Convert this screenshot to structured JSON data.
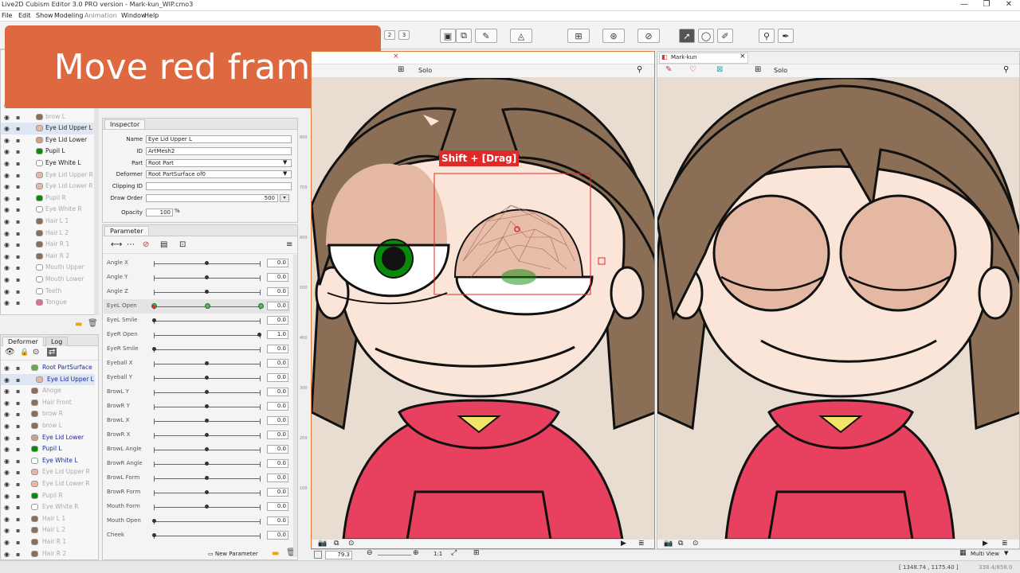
{
  "app": {
    "title": "Live2D Cubism Editor 3.0   PRO version  - Mark-kun_WIP.cmo3",
    "min": "—",
    "max": "❐",
    "close": "✕"
  },
  "menu": [
    "File",
    "Edit",
    "Show",
    "Modeling",
    "Animation",
    "Window",
    "Help"
  ],
  "toolbar": {
    "pages": [
      "1",
      "2",
      "3"
    ]
  },
  "overlay": {
    "text": "Move red frame"
  },
  "parts_tree": {
    "items": [
      {
        "label": "Eyes",
        "color": "#e5b8a4",
        "dim": true
      },
      {
        "label": "brow L",
        "color": "#8a6e55",
        "dim": true
      },
      {
        "label": "Eye Lid Upper L",
        "color": "#e5b8a4",
        "dim": false,
        "selected": true
      },
      {
        "label": "Eye Lid Lower",
        "color": "#c9a28c",
        "dim": false
      },
      {
        "label": "Pupil L",
        "color": "#0a8a0a",
        "dim": false
      },
      {
        "label": "Eye White L",
        "color": "#ffffff",
        "dim": false
      },
      {
        "label": "Eye Lid Upper R",
        "color": "#e5b8a4",
        "dim": true
      },
      {
        "label": "Eye Lid Lower R",
        "color": "#e5b8a4",
        "dim": true
      },
      {
        "label": "Pupil R",
        "color": "#0a8a0a",
        "dim": true
      },
      {
        "label": "Eye White R",
        "color": "#ffffff",
        "dim": true
      },
      {
        "label": "Hair L 1",
        "color": "#8a6e55",
        "dim": true
      },
      {
        "label": "Hair L 2",
        "color": "#8a6e55",
        "dim": true
      },
      {
        "label": "Hair R 1",
        "color": "#8a6e55",
        "dim": true
      },
      {
        "label": "Hair R 2",
        "color": "#8a6e55",
        "dim": true
      },
      {
        "label": "Mouth Upper",
        "color": "#ffffff",
        "dim": true
      },
      {
        "label": "Mouth Lower",
        "color": "#ffffff",
        "dim": true
      },
      {
        "label": "Teeth",
        "color": "#ffffff",
        "dim": true
      },
      {
        "label": "Tongue",
        "color": "#e0708a",
        "dim": true
      }
    ]
  },
  "deformer_panel": {
    "tabs": [
      "Deformer",
      "Log"
    ],
    "items": [
      {
        "label": "Root PartSurface",
        "color": "#6aa84f",
        "dim": false,
        "indent": 0
      },
      {
        "label": "Eye Lid Upper L",
        "color": "#e5b8a4",
        "dim": false,
        "indent": 1,
        "selected": true
      },
      {
        "label": "Ahoge",
        "color": "#8a6e55",
        "dim": true,
        "indent": 0
      },
      {
        "label": "Hair Front",
        "color": "#8a6e55",
        "dim": true,
        "indent": 0
      },
      {
        "label": "brow R",
        "color": "#8a6e55",
        "dim": true,
        "indent": 0
      },
      {
        "label": "brow L",
        "color": "#8a6e55",
        "dim": true,
        "indent": 0
      },
      {
        "label": "Eye Lid Lower",
        "color": "#c9a28c",
        "dim": false,
        "indent": 0
      },
      {
        "label": "Pupil L",
        "color": "#0a8a0a",
        "dim": false,
        "indent": 0
      },
      {
        "label": "Eye White L",
        "color": "#ffffff",
        "dim": false,
        "indent": 0
      },
      {
        "label": "Eye Lid Upper R",
        "color": "#e5b8a4",
        "dim": true,
        "indent": 0
      },
      {
        "label": "Eye Lid Lower R",
        "color": "#e5b8a4",
        "dim": true,
        "indent": 0
      },
      {
        "label": "Pupil R",
        "color": "#0a8a0a",
        "dim": true,
        "indent": 0
      },
      {
        "label": "Eye White R",
        "color": "#ffffff",
        "dim": true,
        "indent": 0
      },
      {
        "label": "Hair L 1",
        "color": "#8a6e55",
        "dim": true,
        "indent": 0
      },
      {
        "label": "Hair L 2",
        "color": "#8a6e55",
        "dim": true,
        "indent": 0
      },
      {
        "label": "Hair R 1",
        "color": "#8a6e55",
        "dim": true,
        "indent": 0
      },
      {
        "label": "Hair R 2",
        "color": "#8a6e55",
        "dim": true,
        "indent": 0
      }
    ]
  },
  "inspector": {
    "title": "Inspector",
    "name_label": "Name",
    "name_value": "Eye Lid Upper L",
    "id_label": "ID",
    "id_value": "ArtMesh2",
    "part_label": "Part",
    "part_value": "Root Part",
    "deformer_label": "Deformer",
    "deformer_value": "Root PartSurface of0",
    "clip_label": "Clipping ID",
    "clip_value": "",
    "draw_label": "Draw Order",
    "draw_value": "500",
    "opacity_label": "Opacity",
    "opacity_value": "100",
    "opacity_unit": "%"
  },
  "parameter": {
    "title": "Parameter",
    "new_button": "New Parameter",
    "rows": [
      {
        "label": "Angle X",
        "value": "0.0",
        "pos": 0.5
      },
      {
        "label": "Angle Y",
        "value": "0.0",
        "pos": 0.5
      },
      {
        "label": "Angle Z",
        "value": "0.0",
        "pos": 0.5
      },
      {
        "label": "EyeL Open",
        "value": "0.0",
        "pos": 0.0,
        "keys": [
          0,
          0.5,
          1
        ],
        "selected": true
      },
      {
        "label": "EyeL Smile",
        "value": "0.0",
        "pos": 0.0
      },
      {
        "label": "EyeR Open",
        "value": "1.0",
        "pos": 1.0
      },
      {
        "label": "EyeR Smile",
        "value": "0.0",
        "pos": 0.0
      },
      {
        "label": "Eyeball X",
        "value": "0.0",
        "pos": 0.5
      },
      {
        "label": "Eyeball Y",
        "value": "0.0",
        "pos": 0.5
      },
      {
        "label": "BrowL Y",
        "value": "0.0",
        "pos": 0.5
      },
      {
        "label": "BrowR Y",
        "value": "0.0",
        "pos": 0.5
      },
      {
        "label": "BrowL X",
        "value": "0.0",
        "pos": 0.5
      },
      {
        "label": "BrowR X",
        "value": "0.0",
        "pos": 0.5
      },
      {
        "label": "BrowL Angle",
        "value": "0.0",
        "pos": 0.5
      },
      {
        "label": "BrowR Angle",
        "value": "0.0",
        "pos": 0.5
      },
      {
        "label": "BrowL Form",
        "value": "0.0",
        "pos": 0.5
      },
      {
        "label": "BrowR Form",
        "value": "0.0",
        "pos": 0.5
      },
      {
        "label": "Mouth Form",
        "value": "0.0",
        "pos": 0.5
      },
      {
        "label": "Mouth Open",
        "value": "0.0",
        "pos": 0.0
      },
      {
        "label": "Cheek",
        "value": "0.0",
        "pos": 0.0
      }
    ]
  },
  "view_left": {
    "solo": "Solo",
    "ruler": [
      "800",
      "700",
      "600",
      "500",
      "400",
      "300",
      "200",
      "100"
    ],
    "hint": "Shift + [Drag]"
  },
  "view_right": {
    "tab": "Mark-kun",
    "close": "×",
    "solo": "Solo"
  },
  "status": {
    "zoom": "79.3",
    "scale": "1:1",
    "multi_view": "Multi View",
    "coords": "[ 1348.74 , 1175.40 ]",
    "extra": "338.4/858.0"
  },
  "colors": {
    "accent": "#de6840",
    "hair": "#8a6e55",
    "skin": "#fbe4d8",
    "lid": "#e5b8a4",
    "hoodie": "#e8405f",
    "pupil": "#0a8a0a",
    "bg": "#e8ddd0",
    "select": "#e02a2a"
  }
}
